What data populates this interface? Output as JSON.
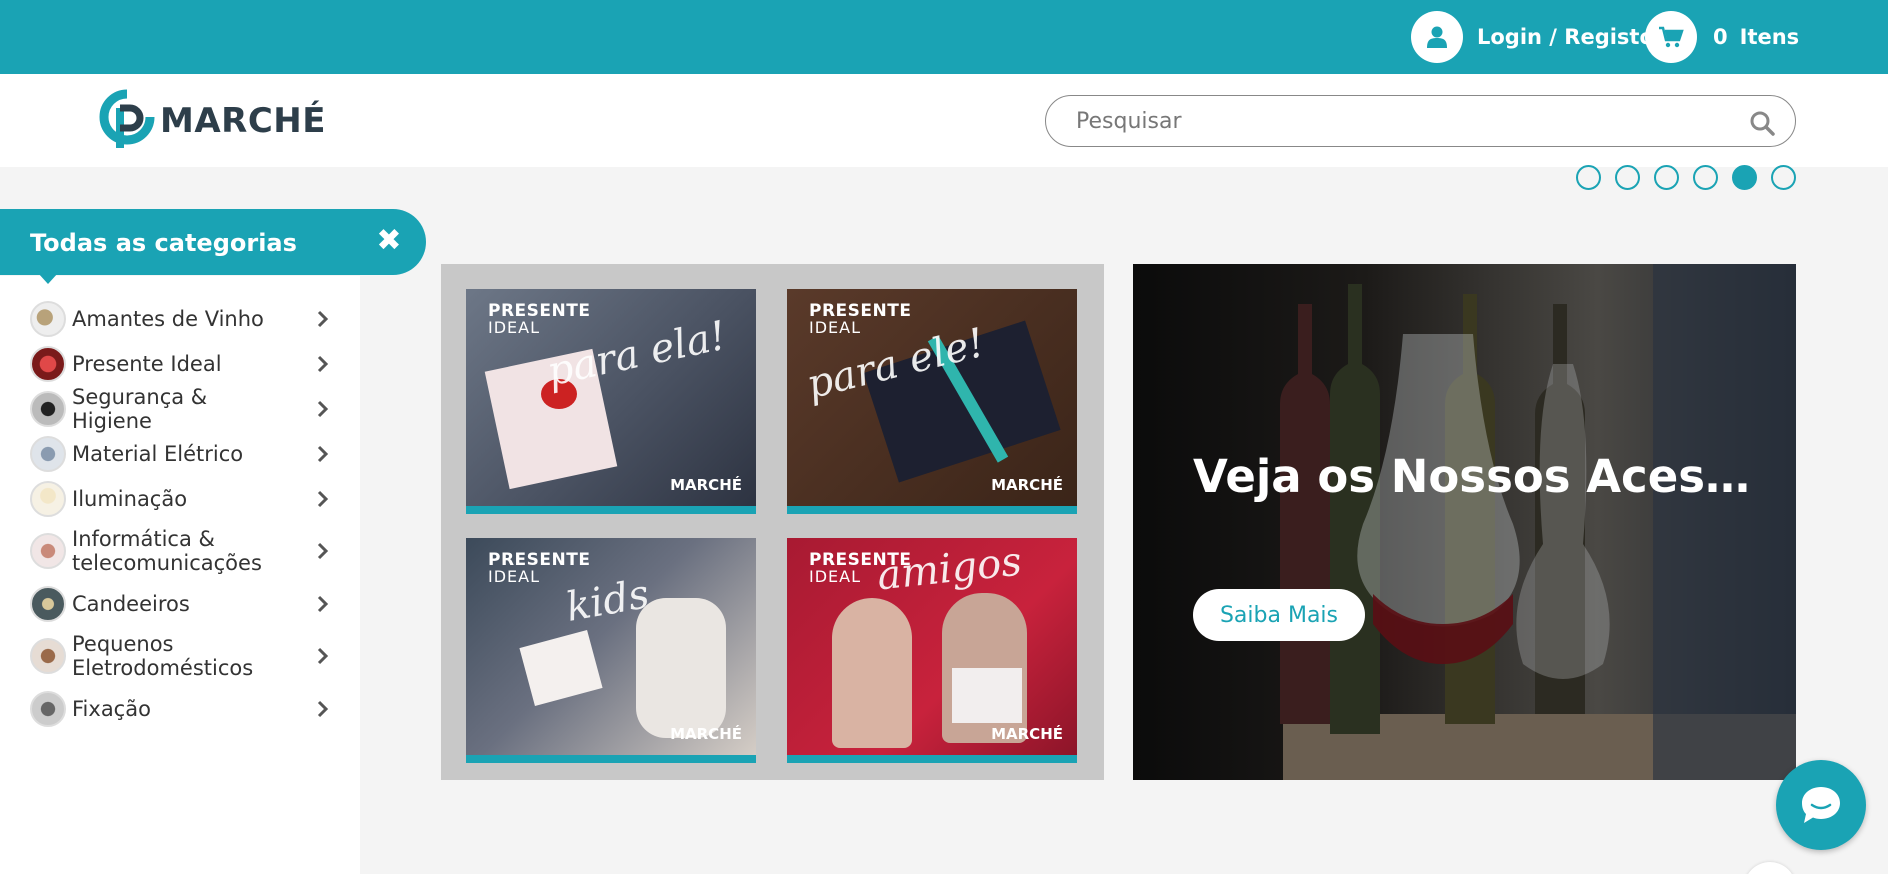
{
  "topbar": {
    "login_label": "Login / Registo",
    "cart_count": "0",
    "cart_label": "Itens",
    "user_icon": "user-icon",
    "cart_icon": "cart-icon"
  },
  "header": {
    "logo_text": "MARCHÉ",
    "search_placeholder": "Pesquisar",
    "search_icon": "search-icon"
  },
  "carousel": {
    "dot_count": 6,
    "active_index": 4
  },
  "categories": {
    "title": "Todas as categorias",
    "close_icon": "close-icon",
    "items": [
      {
        "label": "Amantes de Vinho"
      },
      {
        "label": "Presente Ideal"
      },
      {
        "label": "Segurança & Higiene"
      },
      {
        "label": "Material Elétrico"
      },
      {
        "label": "Iluminação"
      },
      {
        "label": "Informática & telecomunicações"
      },
      {
        "label": "Candeeiros"
      },
      {
        "label": "Pequenos Eletrodomésticos"
      },
      {
        "label": "Fixação"
      }
    ]
  },
  "promos": [
    {
      "title": "PRESENTE",
      "sub": "IDEAL",
      "script": "para ela!",
      "brand": "MARCHÉ"
    },
    {
      "title": "PRESENTE",
      "sub": "IDEAL",
      "script": "para ele!",
      "brand": "MARCHÉ"
    },
    {
      "title": "PRESENTE",
      "sub": "IDEAL",
      "script": "kids",
      "brand": "MARCHÉ"
    },
    {
      "title": "PRESENTE",
      "sub": "IDEAL",
      "script": "amigos",
      "brand": "MARCHÉ"
    }
  ],
  "hero": {
    "title": "Veja os Nossos Acessórios",
    "button_label": "Saiba Mais"
  },
  "colors": {
    "accent": "#1aa3b4",
    "logo_dark": "#2d3e4a"
  }
}
